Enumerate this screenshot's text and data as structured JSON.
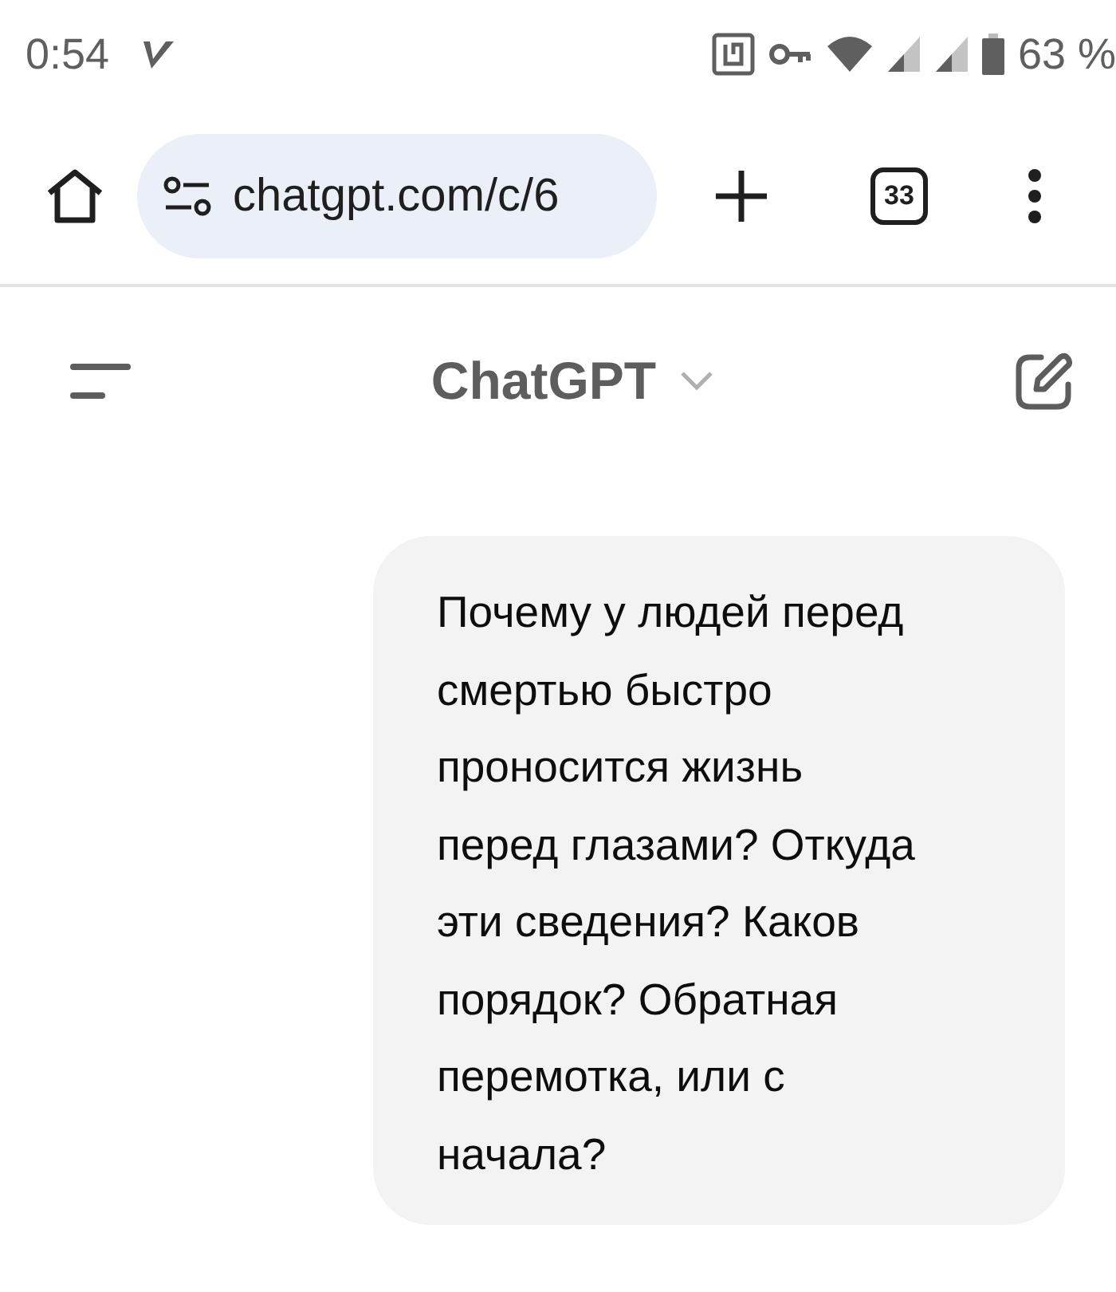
{
  "status_bar": {
    "time": "0:54",
    "battery": "63 %"
  },
  "browser": {
    "url": "chatgpt.com/c/6",
    "tab_count": "33"
  },
  "header": {
    "title": "ChatGPT"
  },
  "messages": [
    {
      "text": "Почему у людей перед\nсмертью быстро\nпроносится жизнь\nперед глазами? Откуда\nэти сведения? Каков\nпорядок? Обратная\nперемотка, или с\nначала?"
    }
  ]
}
